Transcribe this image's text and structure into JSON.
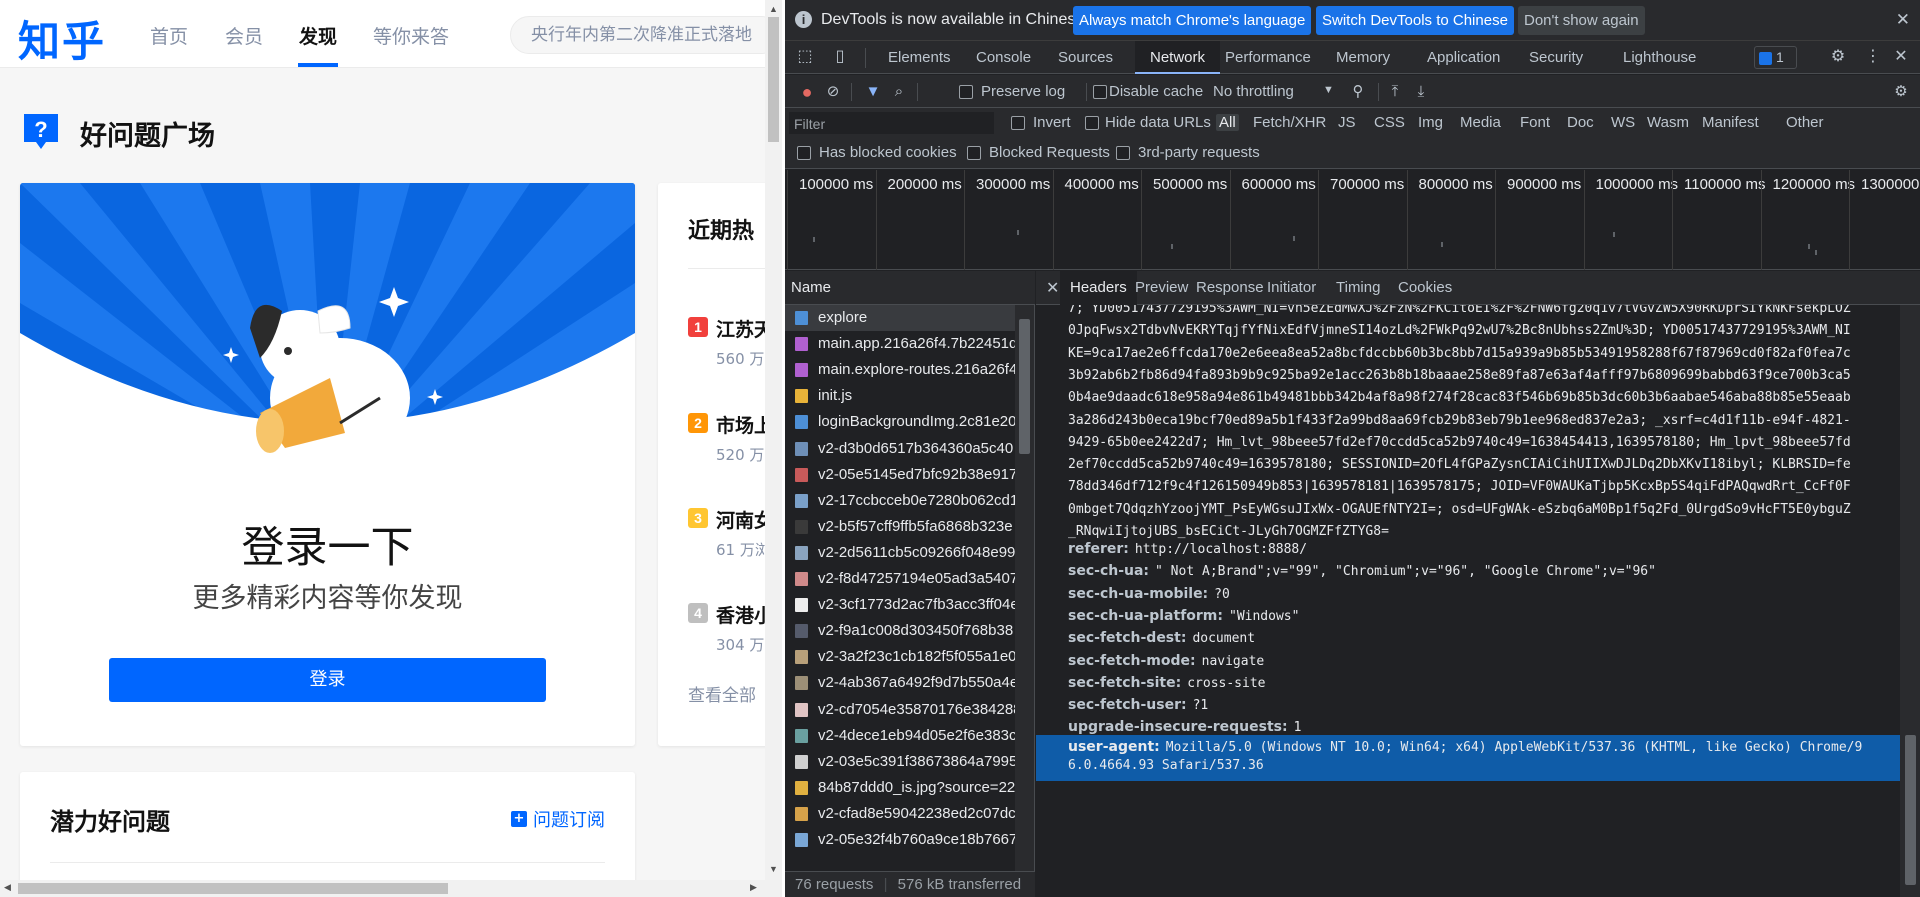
{
  "zhihu": {
    "logo": "知乎",
    "nav": [
      "首页",
      "会员",
      "发现",
      "等你来答"
    ],
    "search_placeholder": "央行年内第二次降准正式落地",
    "page_title": "好问题广场",
    "login_card": {
      "title": "登录一下",
      "subtitle": "更多精彩内容等你发现",
      "button": "登录"
    },
    "hot": {
      "title": "近期热",
      "items": [
        {
          "rank": "1",
          "text": "江苏天",
          "views": "560 万",
          "color": "#f1403c"
        },
        {
          "rank": "2",
          "text": "市场上",
          "views": "520 万",
          "color": "#ff9607"
        },
        {
          "rank": "3",
          "text": "河南女",
          "views": "61 万浏",
          "color": "#ffc631"
        },
        {
          "rank": "4",
          "text": "香港小",
          "views": "304 万",
          "color": "#bfbfbf"
        }
      ],
      "more": "查看全部"
    },
    "potential": {
      "title": "潜力好问题",
      "subscribe": "问题订阅"
    }
  },
  "devtools": {
    "infobar": {
      "text": "DevTools is now available in Chinese!",
      "btn_match": "Always match Chrome's language",
      "btn_switch": "Switch DevTools to Chinese",
      "btn_dismiss": "Don't show again"
    },
    "tabs": [
      "Elements",
      "Console",
      "Sources",
      "Network",
      "Performance",
      "Memory",
      "Application",
      "Security",
      "Lighthouse"
    ],
    "issues_count": "1",
    "toolbar": {
      "preserve_log": "Preserve log",
      "disable_cache": "Disable cache",
      "throttling": "No throttling"
    },
    "filter": {
      "placeholder": "Filter",
      "invert": "Invert",
      "hide_data_urls": "Hide data URLs",
      "types": [
        "All",
        "Fetch/XHR",
        "JS",
        "CSS",
        "Img",
        "Media",
        "Font",
        "Doc",
        "WS",
        "Wasm",
        "Manifest",
        "Other"
      ],
      "has_blocked_cookies": "Has blocked cookies",
      "blocked_requests": "Blocked Requests",
      "third_party": "3rd-party requests"
    },
    "timeline_labels": [
      "100000 ms",
      "200000 ms",
      "300000 ms",
      "400000 ms",
      "500000 ms",
      "600000 ms",
      "700000 ms",
      "800000 ms",
      "900000 ms",
      "1000000 ms",
      "1100000 ms",
      "1200000 ms",
      "1300000"
    ],
    "requests": {
      "header": "Name",
      "rows": [
        {
          "name": "explore",
          "icon": "doc-icon",
          "color": "#4d8fd6"
        },
        {
          "name": "main.app.216a26f4.7b22451d",
          "icon": "css-icon",
          "color": "#b060d0"
        },
        {
          "name": "main.explore-routes.216a26f4",
          "icon": "css-icon",
          "color": "#b060d0"
        },
        {
          "name": "init.js",
          "icon": "js-icon",
          "color": "#e8b339"
        },
        {
          "name": "loginBackgroundImg.2c81e20",
          "icon": "doc-icon",
          "color": "#4d8fd6"
        },
        {
          "name": "v2-d3b0d6517b364360a5c40",
          "icon": "img-icon",
          "color": "#6e8fb7"
        },
        {
          "name": "v2-05e5145ed7bfc92b38e917",
          "icon": "img-icon",
          "color": "#c85a5a"
        },
        {
          "name": "v2-17ccbcceb0e7280b062cd1",
          "icon": "img-icon",
          "color": "#7aa0c9"
        },
        {
          "name": "v2-b5f57cff9ffb5fa6868b323e",
          "icon": "img-icon",
          "color": "#3a3a3a"
        },
        {
          "name": "v2-2d5611cb5c09266f048e99",
          "icon": "img-icon",
          "color": "#8aa4bf"
        },
        {
          "name": "v2-f8d47257194e05ad3a5407",
          "icon": "img-icon",
          "color": "#d08a8a"
        },
        {
          "name": "v2-3cf1773d2ac7fb3acc3ff04e",
          "icon": "img-icon",
          "color": "#ededed"
        },
        {
          "name": "v2-f9a1c008d303450f768b38",
          "icon": "img-icon",
          "color": "#555b6b"
        },
        {
          "name": "v2-3a2f23c1cb182f5f055a1e0",
          "icon": "img-icon",
          "color": "#b8a07a"
        },
        {
          "name": "v2-4ab367a6492f9d7b550a4e",
          "icon": "img-icon",
          "color": "#9c8f77"
        },
        {
          "name": "v2-cd7054e35870176e384288",
          "icon": "img-icon",
          "color": "#e0c4c4"
        },
        {
          "name": "v2-4dece1eb94d05e2f6e383c",
          "icon": "img-icon",
          "color": "#6aa0a0"
        },
        {
          "name": "v2-03e5c391f38673864a7995",
          "icon": "img-icon",
          "color": "#d0d0d0"
        },
        {
          "name": "84b87ddd0_is.jpg?source=22",
          "icon": "img-icon",
          "color": "#e0b040"
        },
        {
          "name": "v2-cfad8e59042238ed2c07dc",
          "icon": "img-icon",
          "color": "#d6a24a"
        },
        {
          "name": "v2-05e32f4b760a9ce18b7667",
          "icon": "img-icon",
          "color": "#7aa7d6"
        }
      ],
      "summary_requests": "76 requests",
      "summary_transferred": "576 kB transferred"
    },
    "detail_tabs": [
      "Headers",
      "Preview",
      "Response",
      "Initiator",
      "Timing",
      "Cookies"
    ],
    "cookie_lines": [
      "7; YD00517437729195%3AWM_NI=vn5eZEdMwXJ%2FzN%2FKCitoEI%2F%2FNW6fg20q1v7tVGvZW5X90RKDprSIYkNKFsekpLOZ",
      "0JpqFwsx2TdbvNvEKRYTqjfYfNixEdfVjmneSI14ozLd%2FWkPq92wU7%2Bc8nUbhss2ZmU%3D; YD00517437729195%3AWM_NI",
      "KE=9ca17ae2e6ffcda170e2e6eea8ea52a8bcfdccbb60b3bc8bb7d15a939a9b85b53491958288f67f87969cd0f82af0fea7c",
      "3b92ab6b2fb86d94fa893b9b9c925ba92e1acc263b8b18baaae258e89fa87e63af4afff97b6809699babbd63f9ce700b3ca5",
      "0b4ae9daadc618e958a94e861b49481bbb342b4af8a98f274f28cac83f546b69b85b3dc60b3b6aabae546aba88b85e55eaab",
      "3a286d243b0eca19bcf70ed89a5b1f433f2a99bd8aa69fcb29b83eb79b1ee968ed837e2a3; _xsrf=c4d1f11b-e94f-4821-",
      "9429-65b0ee2422d7; Hm_lvt_98beee57fd2ef70ccdd5ca52b9740c49=1638454413,1639578180; Hm_lpvt_98beee57fd",
      "2ef70ccdd5ca52b9740c49=1639578180; SESSIONID=2OfL4fGPaZysnCIAiCihUIIXwDJLDq2DbXKvI18ibyl; KLBRSID=fe",
      "78dd346df712f9c4f126150949b853|1639578181|1639578175; JOID=VF0WAUKaTjbp5KcxBp5S4qiFdPAQqwdRrt_CcFf0F",
      "0mbget7QdqzhYzoojYMT_PsEyWGsuJIxWx-OGAUEfNTY2I=; osd=UFgWAk-eSzbq6aM0Bp1f5q2Fd_0UrgdSo9vHcFT5E0ybguZ",
      "_RNqwiIjtojUBS_bsECiCt-JLyGh7OGMZFfZTYG8="
    ],
    "headers": [
      {
        "key": "referer:",
        "value": "http://localhost:8888/"
      },
      {
        "key": "sec-ch-ua:",
        "value": "\" Not A;Brand\";v=\"99\", \"Chromium\";v=\"96\", \"Google Chrome\";v=\"96\""
      },
      {
        "key": "sec-ch-ua-mobile:",
        "value": "?0"
      },
      {
        "key": "sec-ch-ua-platform:",
        "value": "\"Windows\""
      },
      {
        "key": "sec-fetch-dest:",
        "value": "document"
      },
      {
        "key": "sec-fetch-mode:",
        "value": "navigate"
      },
      {
        "key": "sec-fetch-site:",
        "value": "cross-site"
      },
      {
        "key": "sec-fetch-user:",
        "value": "?1"
      },
      {
        "key": "upgrade-insecure-requests:",
        "value": "1"
      }
    ],
    "user_agent": {
      "key": "user-agent:",
      "line1": "Mozilla/5.0 (Windows NT 10.0; Win64; x64) AppleWebKit/537.36 (KHTML, like Gecko) Chrome/9",
      "line2": "6.0.4664.93 Safari/537.36"
    }
  }
}
